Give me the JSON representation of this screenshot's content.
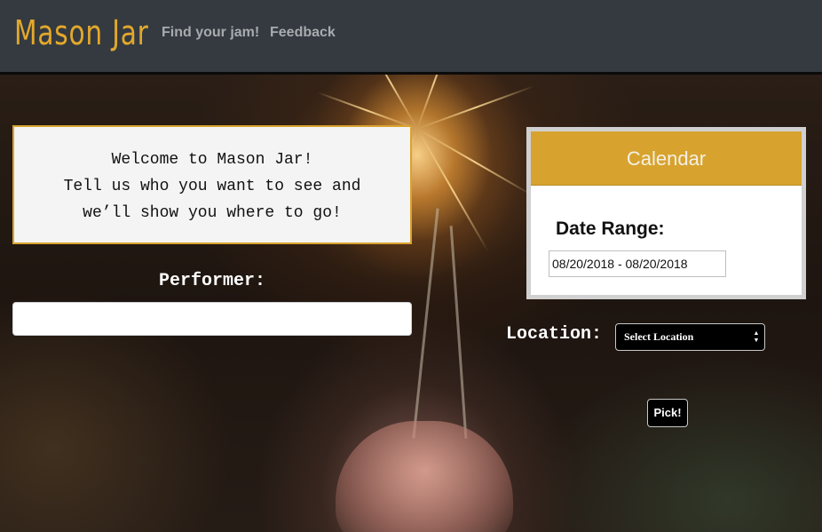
{
  "navbar": {
    "brand": "Mason Jar",
    "links": [
      {
        "label": "Find your jam!"
      },
      {
        "label": "Feedback"
      }
    ]
  },
  "welcome": {
    "lines": [
      "Welcome to Mason Jar!",
      "Tell us who you want to see and",
      "we’ll show you where to go!"
    ]
  },
  "performer": {
    "label": "Performer:",
    "value": "",
    "placeholder": ""
  },
  "calendar": {
    "title": "Calendar",
    "date_range_label": "Date Range:",
    "date_range_value": "08/20/2018 - 08/20/2018"
  },
  "location": {
    "label": "Location:",
    "selected": "Select Location"
  },
  "pick": {
    "label": "Pick!"
  },
  "colors": {
    "brand": "#e3a82b",
    "navbar": "#343a40",
    "calendar_header": "#d7a32e",
    "welcome_border": "#d9a330"
  }
}
